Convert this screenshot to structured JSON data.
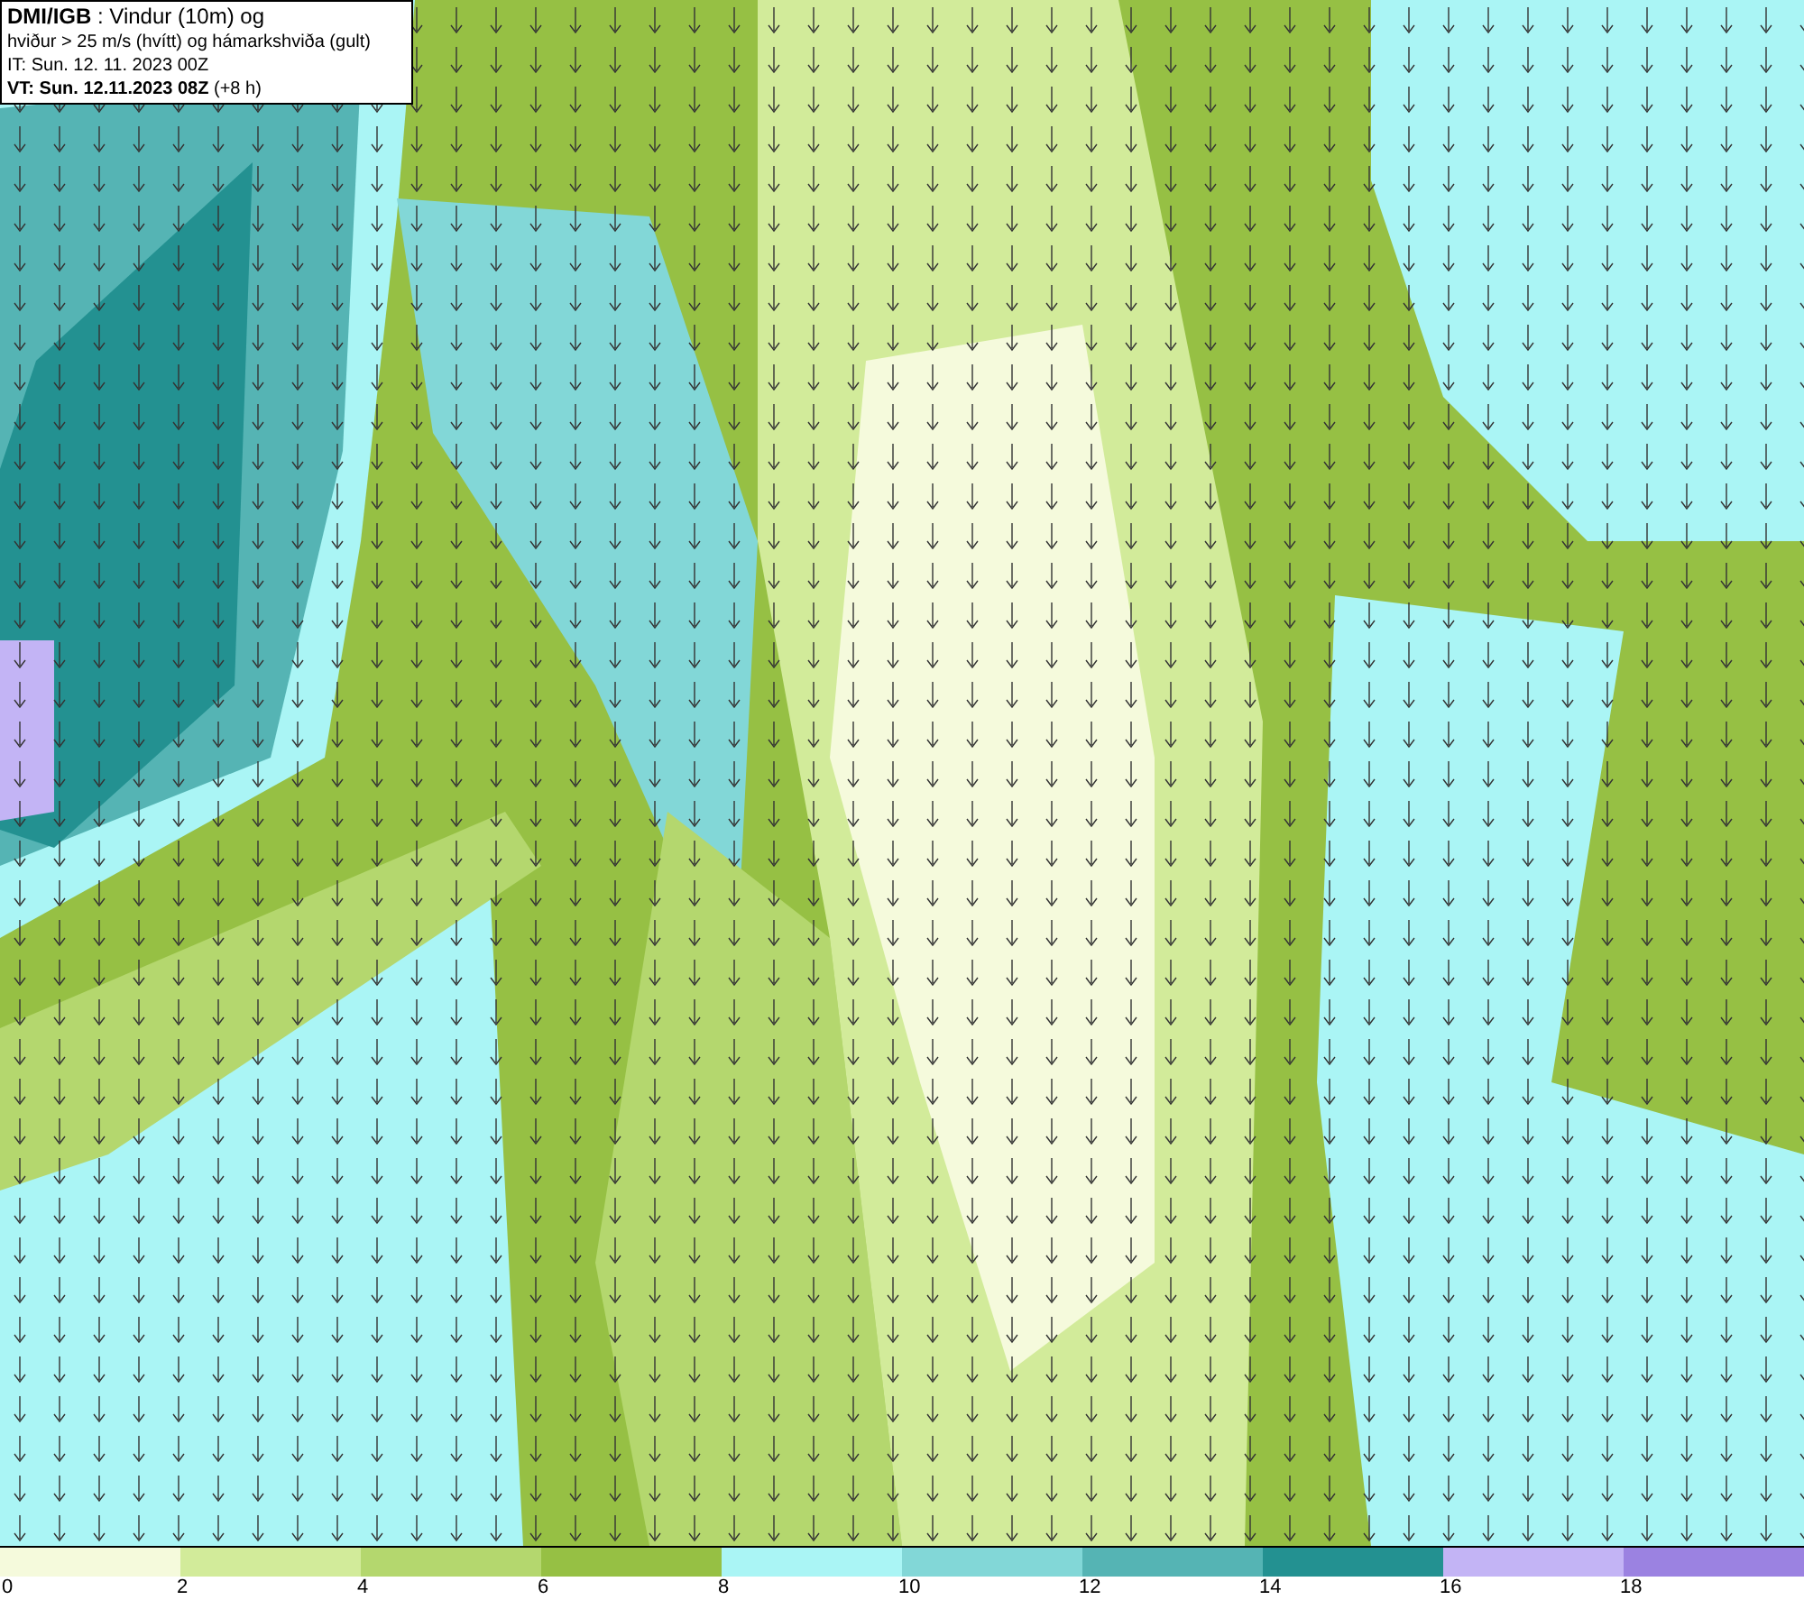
{
  "title_box": {
    "lines": [
      "**DMI/IGB** : Vindur (10m) og",
      "hviður > 25 m/s (hvítt) og hámarkshviða (gult)",
      "IT: Sun. 12. 11. 2023 00Z",
      "**VT: Sun. 12.11.2023 08Z** (+8 h)"
    ]
  },
  "legend": [
    {
      "label": "0",
      "color": "#f5fadc"
    },
    {
      "label": "2",
      "color": "#d2eb9a"
    },
    {
      "label": "4",
      "color": "#b4d76e"
    },
    {
      "label": "6",
      "color": "#96c044"
    },
    {
      "label": "8",
      "color": "#aaf5f5"
    },
    {
      "label": "10",
      "color": "#82d7d7"
    },
    {
      "label": "12",
      "color": "#55b4b4"
    },
    {
      "label": "14",
      "color": "#239191"
    },
    {
      "label": "16",
      "color": "#c3b4f5"
    },
    {
      "label": "18",
      "color": "#9b82e1"
    }
  ]
}
